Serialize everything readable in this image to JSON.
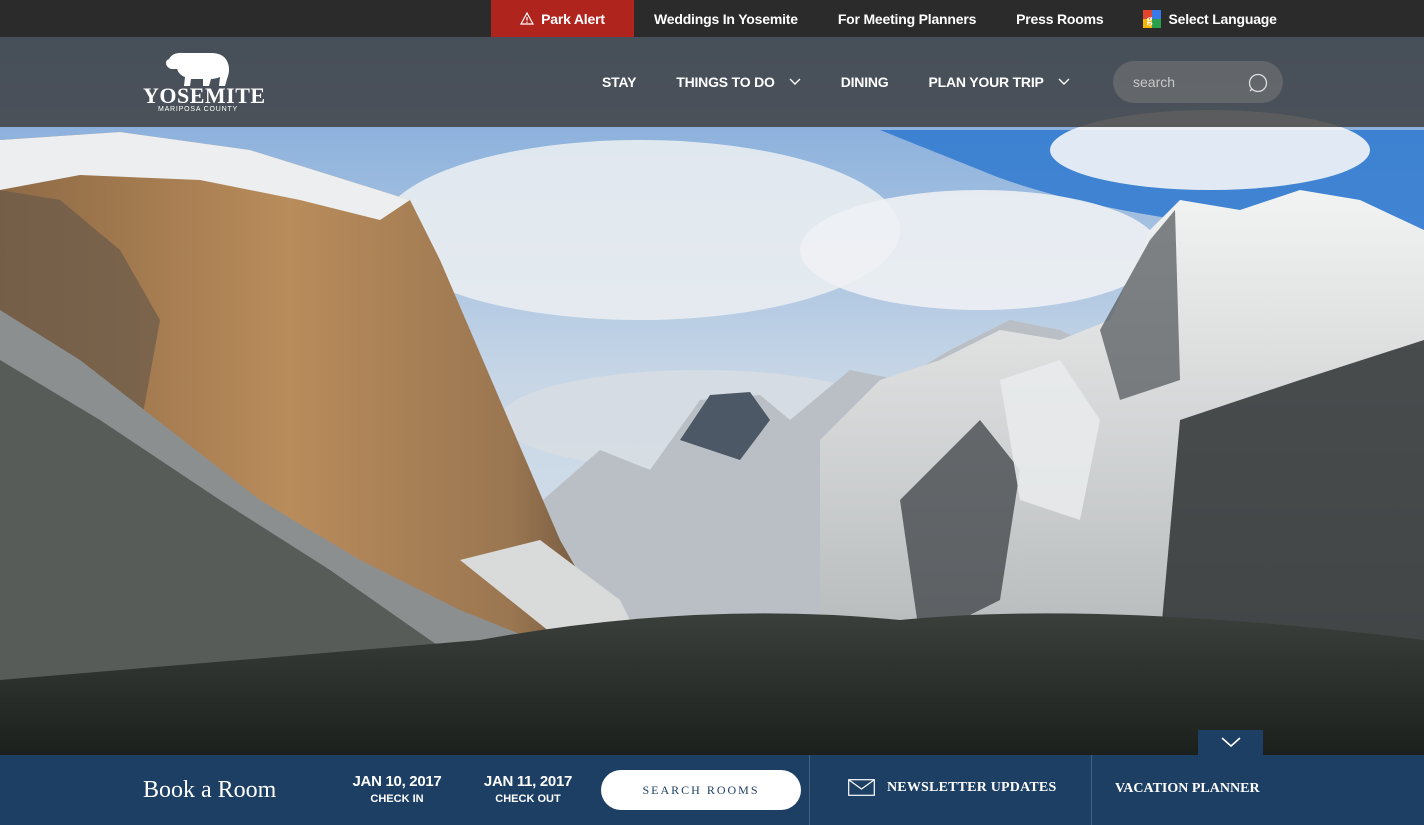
{
  "utility": {
    "park_alert": "Park Alert",
    "links": [
      "Weddings In Yosemite",
      "For Meeting Planners",
      "Press Rooms"
    ],
    "language": "Select Language"
  },
  "logo": {
    "name": "YOSEMITE",
    "subtitle": "MARIPOSA COUNTY"
  },
  "nav": {
    "items": [
      {
        "label": "STAY",
        "dropdown": false
      },
      {
        "label": "THINGS TO DO",
        "dropdown": true
      },
      {
        "label": "DINING",
        "dropdown": false
      },
      {
        "label": "PLAN YOUR TRIP",
        "dropdown": true
      }
    ]
  },
  "search": {
    "placeholder": "search"
  },
  "booking": {
    "title": "Book a Room",
    "check_in_date": "JAN 10, 2017",
    "check_in_label": "CHECK IN",
    "check_out_date": "JAN 11, 2017",
    "check_out_label": "CHECK OUT",
    "search_button": "SEARCH ROOMS",
    "newsletter": "NEWSLETTER UPDATES",
    "planner": "VACATION PLANNER"
  },
  "colors": {
    "alert": "#b0241e",
    "booking_bar": "#1d3f63",
    "utility_bar": "#2b2b2b"
  }
}
